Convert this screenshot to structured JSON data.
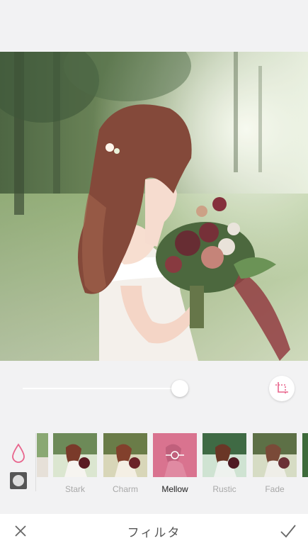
{
  "editor": {
    "title": "フィルタ",
    "intensity": 0.99,
    "accent_color": "#e8648c"
  },
  "filters": [
    {
      "label": "",
      "selected": false
    },
    {
      "label": "Stark",
      "selected": false
    },
    {
      "label": "Charm",
      "selected": false
    },
    {
      "label": "Mellow",
      "selected": true
    },
    {
      "label": "Rustic",
      "selected": false
    },
    {
      "label": "Fade",
      "selected": false
    },
    {
      "label": "",
      "selected": false
    }
  ],
  "icons": {
    "cancel": "close-icon",
    "confirm": "checkmark-icon",
    "crop": "crop-icon",
    "tone": "drop-icon",
    "shape": "vignette-icon"
  }
}
